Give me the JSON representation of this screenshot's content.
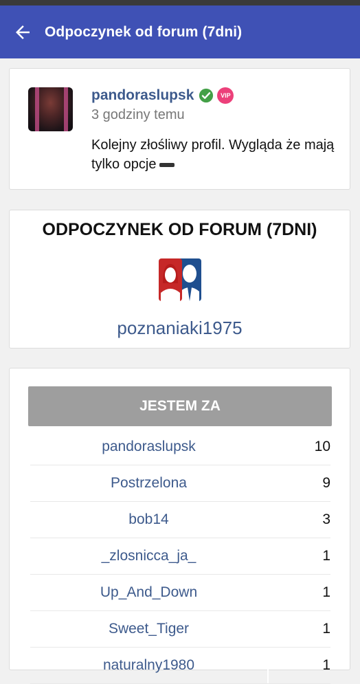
{
  "header": {
    "title": "Odpoczynek od forum (7dni)"
  },
  "post": {
    "username": "pandoraslupsk",
    "vip_label": "VIP",
    "time_ago": "3 godziny temu",
    "text": "Kolejny złośliwy profil. Wygląda że mają tylko opcje"
  },
  "topic": {
    "title": "ODPOCZYNEK OD FORUM (7DNI)",
    "user": "poznaniaki1975"
  },
  "votes": {
    "button_label": "JESTEM ZA",
    "rows": [
      {
        "name": "pandoraslupsk",
        "count": "10"
      },
      {
        "name": "Postrzelona",
        "count": "9"
      },
      {
        "name": "bob14",
        "count": "3"
      },
      {
        "name": "_zlosnicca_ja_",
        "count": "1"
      },
      {
        "name": "Up_And_Down",
        "count": "1"
      },
      {
        "name": "Sweet_Tiger",
        "count": "1"
      },
      {
        "name": "naturalny1980",
        "count": "1"
      }
    ]
  },
  "colors": {
    "appbar": "#3f51b5",
    "link": "#3d5a8c",
    "verified": "#43a047",
    "vip": "#ec407a",
    "vote_button": "#9e9e9e"
  }
}
